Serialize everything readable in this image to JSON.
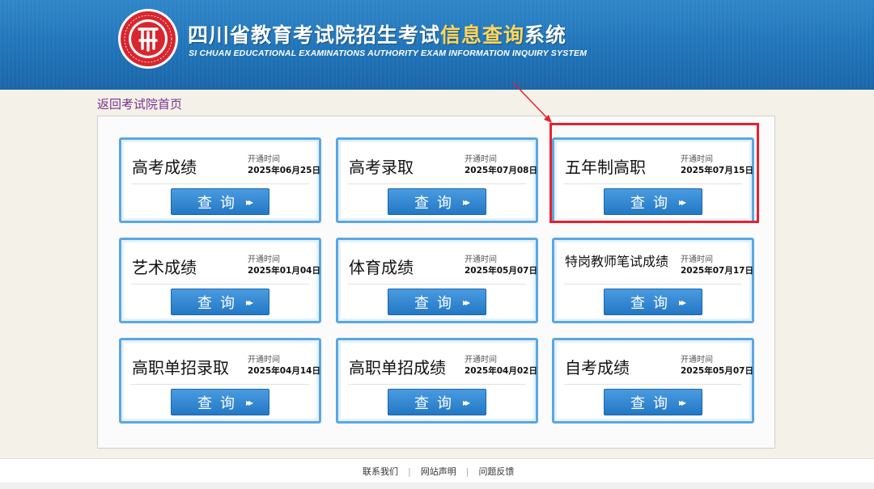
{
  "header": {
    "title_part1": "四川省教育考试院招生考试",
    "title_highlight": "信息查询",
    "title_part2": "系统",
    "subtitle": "SI CHUAN EDUCATIONAL EXAMINATIONS AUTHORITY EXAM INFORMATION INQUIRY SYSTEM"
  },
  "back_link": "返回考试院首页",
  "open_label": "开通时间",
  "query_label": "查询",
  "query_arrow": "▸▸",
  "cards": [
    {
      "name": "高考成绩",
      "date": "2025年06月25日"
    },
    {
      "name": "高考录取",
      "date": "2025年07月08日"
    },
    {
      "name": "五年制高职",
      "date": "2025年07月15日"
    },
    {
      "name": "艺术成绩",
      "date": "2025年01月04日"
    },
    {
      "name": "体育成绩",
      "date": "2025年05月07日"
    },
    {
      "name": "特岗教师笔试成绩",
      "date": "2025年07月17日"
    },
    {
      "name": "高职单招录取",
      "date": "2025年04月14日"
    },
    {
      "name": "高职单招成绩",
      "date": "2025年04月02日"
    },
    {
      "name": "自考成绩",
      "date": "2025年05月07日"
    }
  ],
  "footer": {
    "links": [
      "联系我们",
      "网站声明",
      "问题反馈"
    ]
  },
  "colors": {
    "header_blue": "#2378c5",
    "highlight": "#ffd75e",
    "annotation_red": "#e8212b",
    "link_purple": "#7a2f8f"
  }
}
